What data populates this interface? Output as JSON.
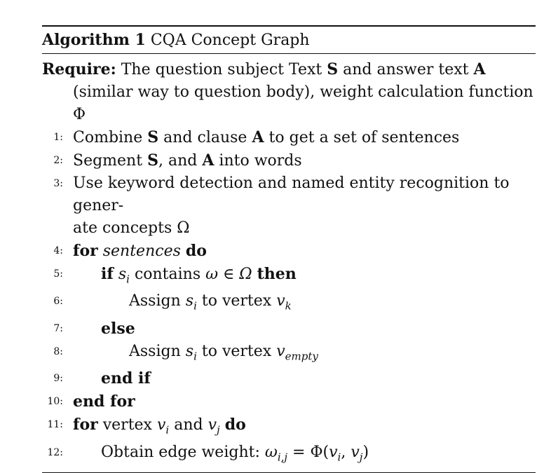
{
  "algorithm": {
    "label": "Algorithm 1",
    "title": "CQA Concept Graph"
  },
  "require": {
    "keyword": "Require:",
    "text_a": "The question subject Text",
    "s": "S",
    "text_b": "and answer text",
    "a": "A",
    "text_c": "(similar",
    "text_d": "way to question body), weight calculation function Φ"
  },
  "steps": [
    {
      "num": "1:",
      "pre": "Combine",
      "s": "S",
      "mid": "and clause",
      "a": "A",
      "post": "to get a set of sentences"
    },
    {
      "num": "2:",
      "pre": "Segment",
      "s": "S",
      "mid": ", and",
      "a": "A",
      "post": "into words"
    },
    {
      "num": "3:",
      "line1": "Use keyword detection and named entity recognition to gener-",
      "line2": "ate concepts Ω"
    },
    {
      "num": "4:",
      "kw1": "for",
      "var": "sentences",
      "kw2": "do"
    },
    {
      "num": "5:",
      "kw1": "if",
      "v": "s",
      "sub": "i",
      "mid": "contains",
      "expr": "ω ∈ Ω",
      "kw2": "then"
    },
    {
      "num": "6:",
      "pre": "Assign",
      "v": "s",
      "sub": "i",
      "mid": "to vertex",
      "v2": "v",
      "sub2": "k"
    },
    {
      "num": "7:",
      "kw1": "else"
    },
    {
      "num": "8:",
      "pre": "Assign",
      "v": "s",
      "sub": "i",
      "mid": "to vertex",
      "v2": "v",
      "sub2": "empty"
    },
    {
      "num": "9:",
      "kw1": "end if"
    },
    {
      "num": "10:",
      "kw1": "end for"
    },
    {
      "num": "11:",
      "kw1": "for",
      "mid": "vertex",
      "v": "v",
      "sub": "i",
      "and": "and",
      "v2": "v",
      "sub2": "j",
      "kw2": "do"
    },
    {
      "num": "12:",
      "pre": "Obtain edge weight:",
      "w": "ω",
      "wsub": "i,j",
      "eq": "= Φ(",
      "v": "v",
      "sub": "i",
      "comma": ",",
      "v2": "v",
      "sub2": "j",
      "close": ")"
    }
  ]
}
